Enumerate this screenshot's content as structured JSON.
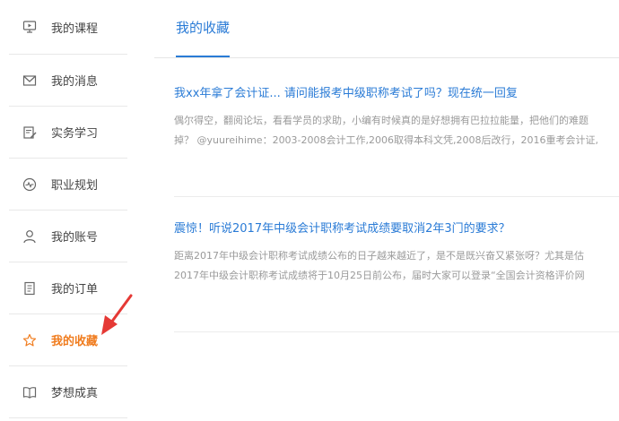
{
  "sidebar": {
    "items": [
      {
        "label": "我的课程",
        "icon": "monitor-icon"
      },
      {
        "label": "我的消息",
        "icon": "envelope-icon"
      },
      {
        "label": "实务学习",
        "icon": "edit-note-icon"
      },
      {
        "label": "职业规划",
        "icon": "pulse-circle-icon"
      },
      {
        "label": "我的账号",
        "icon": "user-icon"
      },
      {
        "label": "我的订单",
        "icon": "document-icon"
      },
      {
        "label": "我的收藏",
        "icon": "star-icon",
        "active": true
      },
      {
        "label": "梦想成真",
        "icon": "open-book-icon"
      }
    ]
  },
  "main": {
    "tab_label": "我的收藏",
    "articles": [
      {
        "title": "我xx年拿了会计证... 请问能报考中级职称考试了吗？现在统一回复",
        "line1": "偶尔得空，翻阅论坛，看看学员的求助，小编有时候真的是好想拥有巴拉拉能量，把他们的难题",
        "line2": "掉？ @yuureihime：2003-2008会计工作,2006取得本科文凭,2008后改行，2016重考会计证,"
      },
      {
        "title": "震惊！听说2017年中级会计职称考试成绩要取消2年3门的要求？",
        "line1": "距离2017年中级会计职称考试成绩公布的日子越来越近了，是不是既兴奋又紧张呀？尤其是估",
        "line2": "2017年中级会计职称考试成绩将于10月25日前公布，届时大家可以登录“全国会计资格评价网"
      }
    ]
  },
  "colors": {
    "accent": "#2a7bd6",
    "active": "#f07c1e",
    "arrow": "#e53935"
  }
}
